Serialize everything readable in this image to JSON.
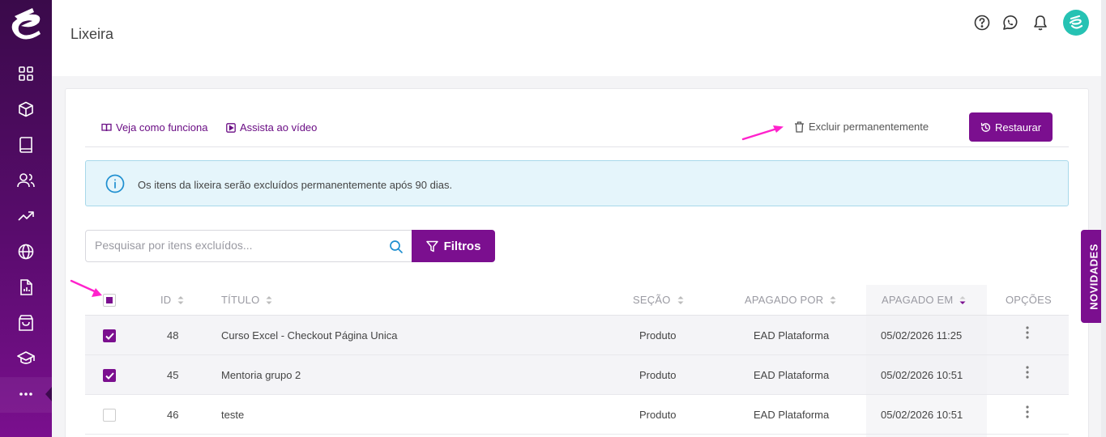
{
  "header": {
    "title": "Lixeira",
    "icons": [
      "help-circle-icon",
      "whatsapp-icon",
      "bell-icon",
      "user-avatar"
    ]
  },
  "sidebar": {
    "items": [
      "dashboard-grid-icon",
      "box-icon",
      "book-icon",
      "users-icon",
      "trending-up-icon",
      "globe-icon",
      "report-icon",
      "shopping-bag-icon",
      "graduation-cap-icon",
      "more-icon"
    ]
  },
  "toolbar": {
    "how_it_works": "Veja como funciona",
    "watch_video": "Assista ao vídeo",
    "delete_permanently": "Excluir permanentemente",
    "restore": "Restaurar"
  },
  "info": {
    "message": "Os itens da lixeira serão excluídos permanentemente após 90 dias."
  },
  "search": {
    "placeholder": "Pesquisar por itens excluídos...",
    "value": "",
    "filters_label": "Filtros"
  },
  "table": {
    "columns": {
      "id": "ID",
      "title": "TÍTULO",
      "section": "SEÇÃO",
      "deleted_by": "APAGADO POR",
      "deleted_at": "APAGADO EM",
      "options": "OPÇÕES"
    },
    "sorted_column": "deleted_at",
    "sort_direction": "desc",
    "rows": [
      {
        "checked": true,
        "id": "48",
        "title": "Curso Excel - Checkout Página Unica",
        "section": "Produto",
        "deleted_by": "EAD Plataforma",
        "deleted_at": "05/02/2026 11:25"
      },
      {
        "checked": true,
        "id": "45",
        "title": "Mentoria grupo 2",
        "section": "Produto",
        "deleted_by": "EAD Plataforma",
        "deleted_at": "05/02/2026 10:51"
      },
      {
        "checked": false,
        "id": "46",
        "title": "teste",
        "section": "Produto",
        "deleted_by": "EAD Plataforma",
        "deleted_at": "05/02/2026 10:51"
      }
    ]
  },
  "novidades": "NOVIDADES",
  "colors": {
    "primary": "#7b0f8f",
    "sidebar_top": "#3a0a4a",
    "info_bg": "#e5f5fb",
    "annotation_arrow": "#ff22cc"
  }
}
